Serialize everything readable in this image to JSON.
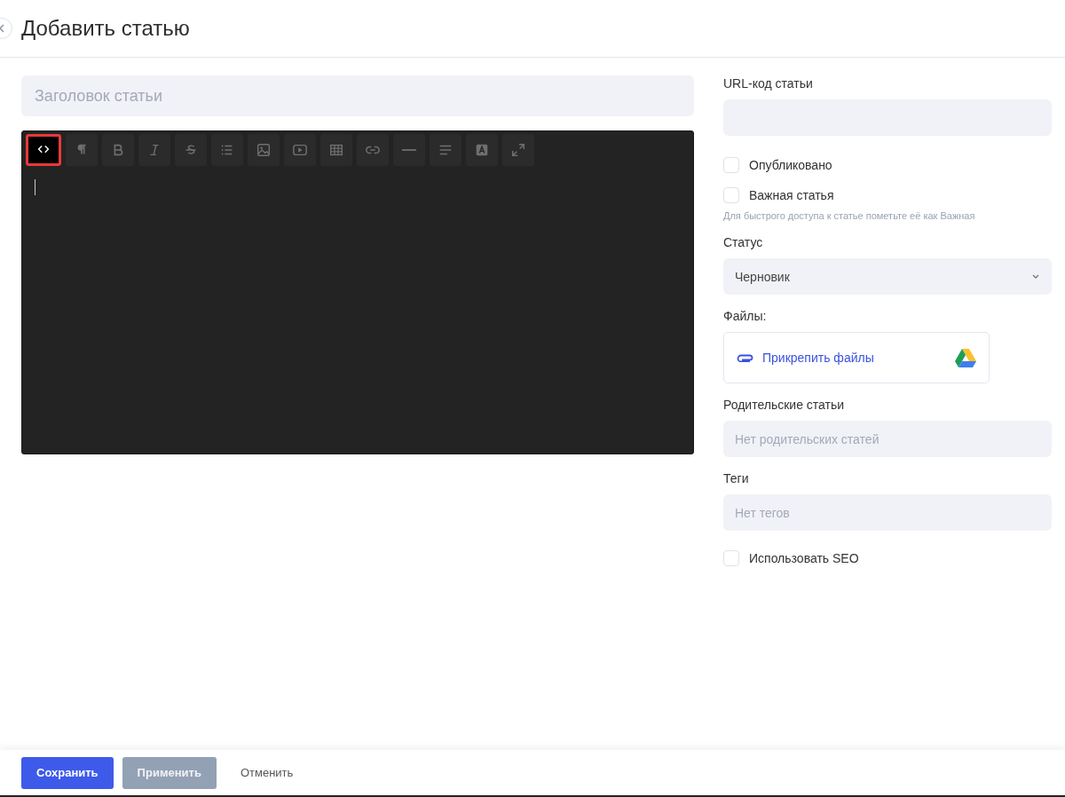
{
  "header": {
    "title": "Добавить статью"
  },
  "article_title": {
    "placeholder": "Заголовок статьи"
  },
  "editor": {
    "toolbar": [
      {
        "kind": "code",
        "selected": true
      },
      {
        "kind": "paragraph",
        "selected": false
      },
      {
        "kind": "bold",
        "selected": false
      },
      {
        "kind": "italic",
        "selected": false
      },
      {
        "kind": "strike",
        "selected": false
      },
      {
        "kind": "list",
        "selected": false
      },
      {
        "kind": "image",
        "selected": false
      },
      {
        "kind": "video",
        "selected": false
      },
      {
        "kind": "table",
        "selected": false
      },
      {
        "kind": "link",
        "selected": false
      },
      {
        "kind": "rule",
        "selected": false
      },
      {
        "kind": "align",
        "selected": false
      },
      {
        "kind": "color",
        "selected": false
      },
      {
        "kind": "fullscreen",
        "selected": false
      }
    ]
  },
  "sidebar": {
    "url_code": {
      "label": "URL-код статьи"
    },
    "checkboxes": [
      {
        "label": "Опубликовано",
        "checked": false
      },
      {
        "label": "Важная статья",
        "checked": false
      }
    ],
    "hint": "Для быстрого доступа к статье пометьте её как Важная",
    "status": {
      "label": "Статус",
      "value": "Черновик"
    },
    "files": {
      "label": "Файлы:",
      "attach": "Прикрепить файлы"
    },
    "parents": {
      "label": "Родительские статьи",
      "placeholder": "Нет родительских статей"
    },
    "tags": {
      "label": "Теги",
      "placeholder": "Нет тегов"
    },
    "seo": {
      "label": "Использовать SEO",
      "checked": false
    }
  },
  "footer": {
    "buttons": [
      {
        "label": "Сохранить",
        "kind": "primary"
      },
      {
        "label": "Применить",
        "kind": "disabled"
      },
      {
        "label": "Отменить",
        "kind": "plain"
      }
    ]
  }
}
